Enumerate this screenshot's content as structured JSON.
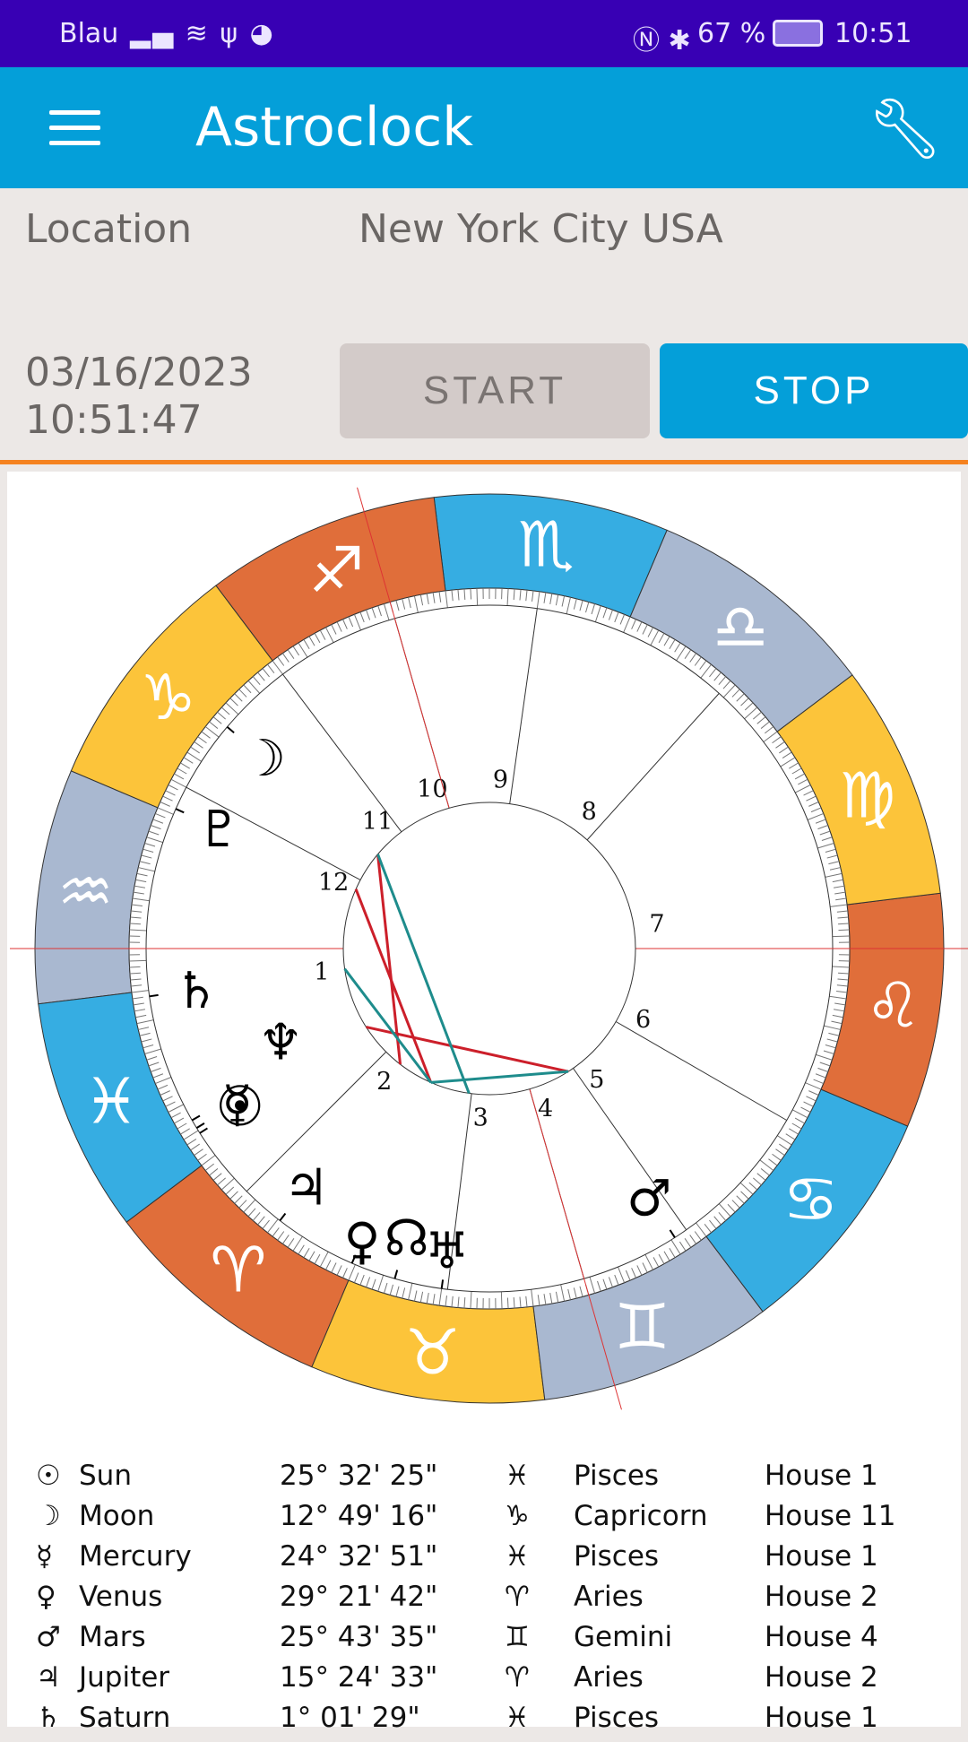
{
  "status_bar": {
    "carrier": "Blau",
    "battery": "67 %",
    "time": "10:51"
  },
  "app_bar": {
    "title": "Astroclock",
    "menu_icon": "hamburger-icon",
    "settings_icon": "wrench-icon"
  },
  "location": {
    "label": "Location",
    "value": "New York City USA"
  },
  "clock": {
    "date": "03/16/2023",
    "time": "10:51:47",
    "start_label": "START",
    "stop_label": "STOP"
  },
  "colors": {
    "status": "#3800b4",
    "appbar": "#049fd9",
    "accent_line": "#f5821f",
    "fire": "#e06e3a",
    "earth": "#fcc43a",
    "air": "#a9b8d0",
    "water": "#36ade2",
    "aspect_hard": "#cc1f2a",
    "aspect_soft": "#1e8c8c"
  },
  "chart": {
    "ascendant": 323,
    "house_cusps": [
      323,
      8,
      46,
      69,
      88,
      113,
      143,
      191,
      225,
      249,
      270,
      295
    ],
    "house_numbers": [
      "1",
      "2",
      "3",
      "4",
      "5",
      "6",
      "7",
      "8",
      "9",
      "10",
      "11",
      "12"
    ],
    "signs": [
      {
        "glyph": "♈",
        "el": "fire"
      },
      {
        "glyph": "♉",
        "el": "earth"
      },
      {
        "glyph": "♊",
        "el": "air"
      },
      {
        "glyph": "♋",
        "el": "water"
      },
      {
        "glyph": "♌",
        "el": "fire"
      },
      {
        "glyph": "♍",
        "el": "earth"
      },
      {
        "glyph": "♎",
        "el": "air"
      },
      {
        "glyph": "♏",
        "el": "water"
      },
      {
        "glyph": "♐",
        "el": "fire"
      },
      {
        "glyph": "♑",
        "el": "earth"
      },
      {
        "glyph": "♒",
        "el": "air"
      },
      {
        "glyph": "♓",
        "el": "water"
      }
    ],
    "bodies": [
      {
        "id": "sun",
        "glyph": "☉",
        "lon": 355.5
      },
      {
        "id": "mercury",
        "glyph": "☿",
        "lon": 354.5
      },
      {
        "id": "moon",
        "glyph": "☽",
        "lon": 282.8
      },
      {
        "id": "venus",
        "glyph": "♀",
        "lon": 29.4
      },
      {
        "id": "mars",
        "glyph": "♂",
        "lon": 85.7
      },
      {
        "id": "jupiter",
        "glyph": "♃",
        "lon": 15.4
      },
      {
        "id": "saturn",
        "glyph": "♄",
        "lon": 331.0
      },
      {
        "id": "uranus",
        "glyph": "♅",
        "lon": 45
      },
      {
        "id": "neptune",
        "glyph": "♆",
        "lon": 353
      },
      {
        "id": "pluto",
        "glyph": "♇",
        "lon": 299
      },
      {
        "id": "node",
        "glyph": "☊",
        "lon": 37
      }
    ],
    "aspects": [
      {
        "a": "sun",
        "b": "mars",
        "type": "hard"
      },
      {
        "a": "moon",
        "b": "jupiter",
        "type": "hard"
      },
      {
        "a": "pluto",
        "b": "venus",
        "type": "hard"
      },
      {
        "a": "moon",
        "b": "uranus",
        "type": "soft"
      },
      {
        "a": "saturn",
        "b": "venus",
        "type": "soft"
      },
      {
        "a": "venus",
        "b": "mars",
        "type": "soft"
      }
    ]
  },
  "planets": [
    {
      "glyph": "☉",
      "name": "Sun",
      "deg": "25° 32' 25\"",
      "sign_glyph": "♓",
      "sign": "Pisces",
      "house": "House 1"
    },
    {
      "glyph": "☽",
      "name": "Moon",
      "deg": "12° 49' 16\"",
      "sign_glyph": "♑",
      "sign": "Capricorn",
      "house": "House 11"
    },
    {
      "glyph": "☿",
      "name": "Mercury",
      "deg": "24° 32' 51\"",
      "sign_glyph": "♓",
      "sign": "Pisces",
      "house": "House 1"
    },
    {
      "glyph": "♀",
      "name": "Venus",
      "deg": "29° 21' 42\"",
      "sign_glyph": "♈",
      "sign": "Aries",
      "house": "House 2"
    },
    {
      "glyph": "♂",
      "name": "Mars",
      "deg": "25° 43' 35\"",
      "sign_glyph": "♊",
      "sign": "Gemini",
      "house": "House 4"
    },
    {
      "glyph": "♃",
      "name": "Jupiter",
      "deg": "15° 24' 33\"",
      "sign_glyph": "♈",
      "sign": "Aries",
      "house": "House 2"
    },
    {
      "glyph": "♄",
      "name": "Saturn",
      "deg": "1° 01' 29\"",
      "sign_glyph": "♓",
      "sign": "Pisces",
      "house": "House 1"
    }
  ]
}
